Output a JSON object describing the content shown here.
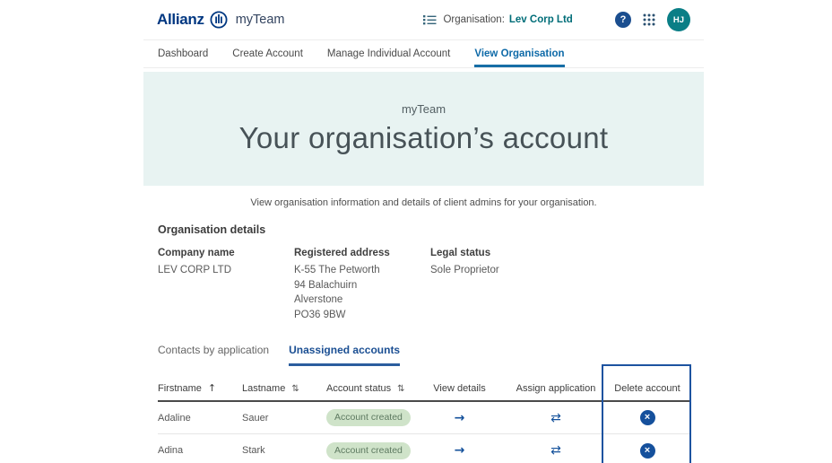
{
  "header": {
    "brand_name": "Allianz",
    "product": "myTeam",
    "org_label": "Organisation:",
    "org_value": "Lev Corp Ltd",
    "help_glyph": "?",
    "avatar_initials": "HJ"
  },
  "nav": {
    "items": [
      {
        "label": "Dashboard",
        "active": false
      },
      {
        "label": "Create Account",
        "active": false
      },
      {
        "label": "Manage Individual Account",
        "active": false
      },
      {
        "label": "View Organisation",
        "active": true
      }
    ]
  },
  "hero": {
    "eyebrow": "myTeam",
    "title": "Your organisation’s account"
  },
  "intro": {
    "text": "View organisation information and details of client admins for your organisation."
  },
  "org_details": {
    "heading": "Organisation details",
    "fields": [
      {
        "label": "Company name",
        "lines": [
          "LEV CORP LTD"
        ]
      },
      {
        "label": "Registered address",
        "lines": [
          "K-55 The Petworth",
          "94 Balachuirn",
          "Alverstone",
          "PO36 9BW"
        ]
      },
      {
        "label": "Legal status",
        "lines": [
          "Sole Proprietor"
        ]
      }
    ]
  },
  "tabs": [
    {
      "label": "Contacts by application",
      "active": false
    },
    {
      "label": "Unassigned accounts",
      "active": true
    }
  ],
  "table": {
    "columns": [
      {
        "label": "Firstname",
        "sort": "asc"
      },
      {
        "label": "Lastname",
        "sort": "both"
      },
      {
        "label": "Account status",
        "sort": "both"
      },
      {
        "label": "View details"
      },
      {
        "label": "Assign application"
      },
      {
        "label": "Delete account",
        "highlighted": true
      }
    ],
    "rows": [
      {
        "firstname": "Adaline",
        "lastname": "Sauer",
        "status": "Account created"
      },
      {
        "firstname": "Adina",
        "lastname": "Stark",
        "status": "Account created"
      }
    ]
  },
  "icons": {
    "sort_asc": "↑",
    "sort_both": "⇅",
    "view_arrow": "→",
    "assign_arrows": "⇄",
    "delete_x": "×"
  },
  "colors": {
    "brand_blue": "#003781",
    "teal_accent": "#006d78",
    "avatar_teal": "#0a7e86",
    "nav_active_blue": "#0e6aa8",
    "tab_active_blue": "#1b4f93",
    "icon_blue": "#14519b",
    "highlight_border": "#1d53a0",
    "hero_background": "#e8f3f2",
    "status_pill_bg": "#cfe3c9",
    "status_pill_text": "#5e7a61"
  }
}
